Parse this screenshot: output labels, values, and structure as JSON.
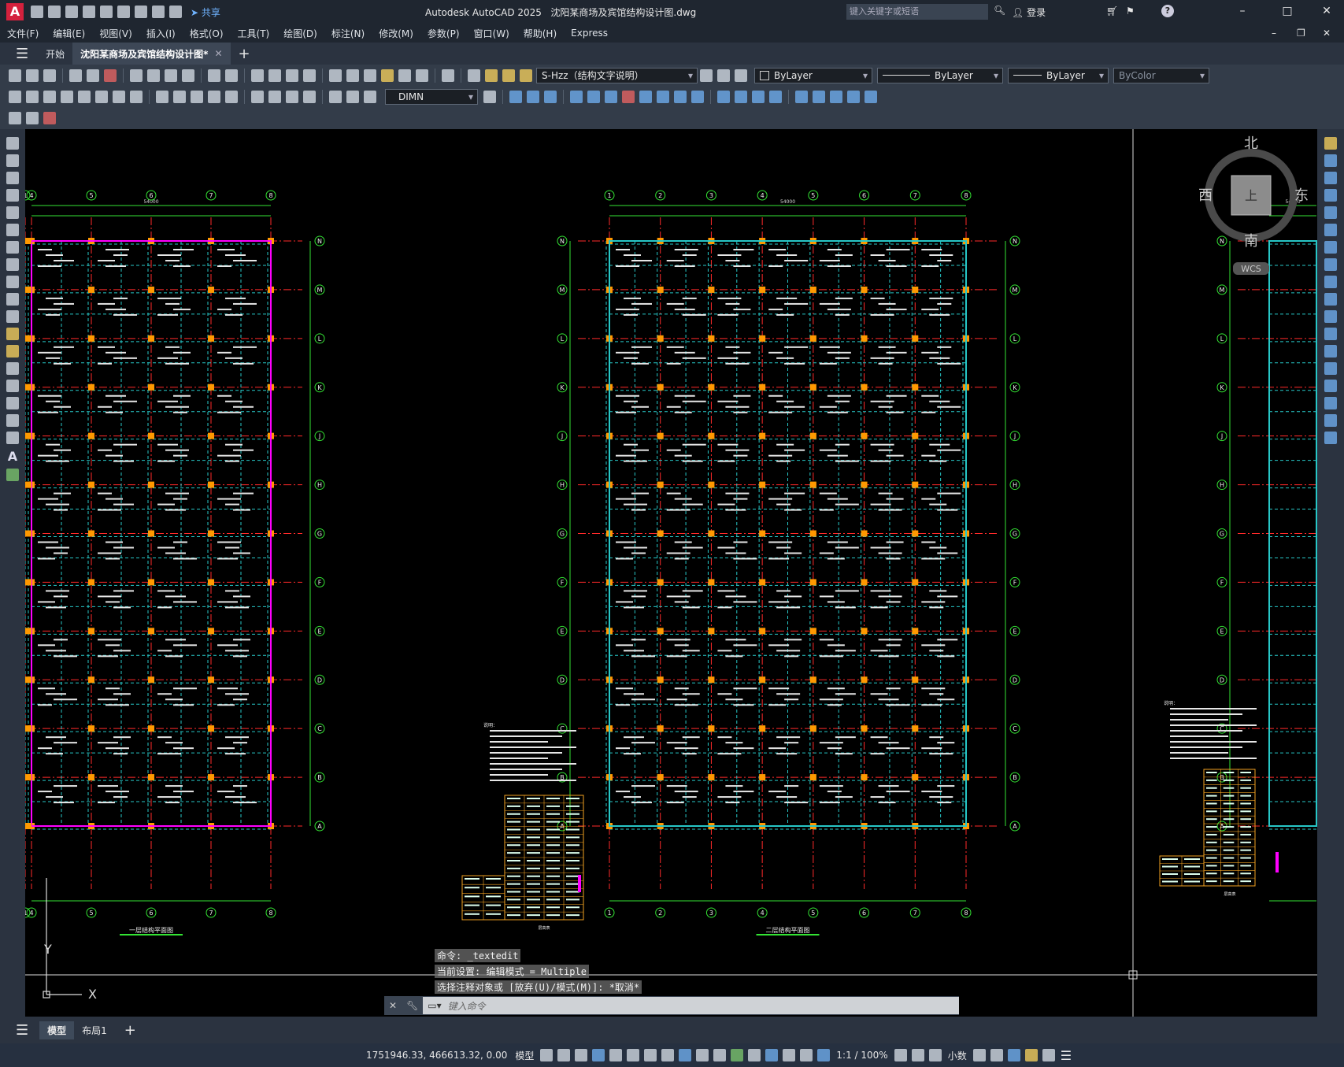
{
  "app": {
    "title": "Autodesk AutoCAD 2025",
    "filename": "沈阳某商场及宾馆结构设计图.dwg",
    "search_placeholder": "键入关键字或短语",
    "login": "登录",
    "share": "共享"
  },
  "menu": [
    "文件(F)",
    "编辑(E)",
    "视图(V)",
    "插入(I)",
    "格式(O)",
    "工具(T)",
    "绘图(D)",
    "标注(N)",
    "修改(M)",
    "参数(P)",
    "窗口(W)",
    "帮助(H)",
    "Express"
  ],
  "tabs": {
    "start": "开始",
    "doc": "沈阳某商场及宾馆结构设计图*"
  },
  "properties": {
    "layer": "S-Hzz（结构文字说明）",
    "color": "ByLayer",
    "linetype": "ByLayer",
    "lineweight": "ByLayer",
    "plotstyle": "ByColor",
    "dimstyle": "DIMN"
  },
  "viewcube": {
    "north": "北",
    "south": "南",
    "east": "东",
    "west": "西",
    "wcs": "WCS",
    "face": "上"
  },
  "commands": [
    "命令: _textedit",
    "当前设置: 编辑模式 = Multiple",
    "选择注释对象或 [放弃(U)/模式(M)]: *取消*"
  ],
  "command_placeholder": "键入命令",
  "ucs": {
    "x": "X",
    "y": "Y"
  },
  "drawing": {
    "left_title": "一层结构平面图",
    "center_title": "二层结构平面图",
    "grid_cols_left": [
      "4",
      "5",
      "6",
      "7",
      "8"
    ],
    "grid_cols_center": [
      "1",
      "2",
      "3",
      "4",
      "5",
      "6",
      "7",
      "8"
    ],
    "grid_rows": [
      "N",
      "M",
      "L",
      "K",
      "J",
      "H",
      "G",
      "F",
      "E",
      "D",
      "C",
      "B",
      "A"
    ],
    "overall_dim": "54000",
    "notes_title": "说明：",
    "table_title": "层高表"
  },
  "layout_tabs": {
    "model": "模型",
    "layout1": "布局1"
  },
  "status": {
    "coords": "1751946.33, 466613.32, 0.00",
    "model": "模型",
    "scale": "1:1 / 100%",
    "units": "小数"
  },
  "colors": {
    "grid_line": "#ff2a2a",
    "beam": "#27c7c7",
    "dim": "#33e333",
    "column": "#ff9900",
    "wall": "#ff00ff",
    "bg": "#000000"
  }
}
